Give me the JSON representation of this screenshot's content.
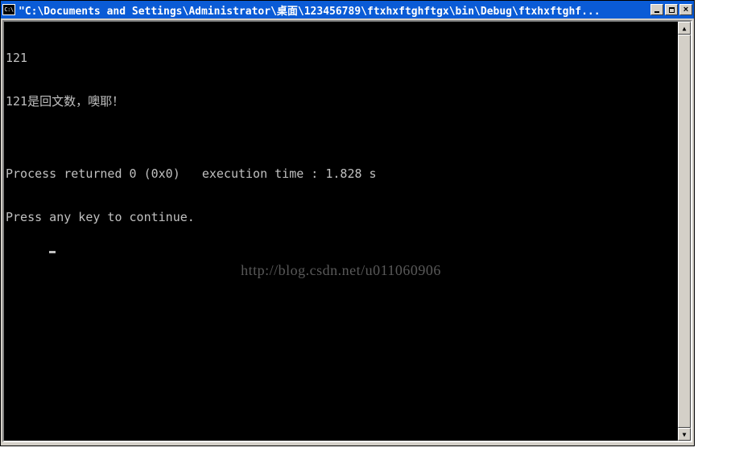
{
  "window": {
    "icon_label": "C:\\",
    "title": "\"C:\\Documents and Settings\\Administrator\\桌面\\123456789\\ftxhxftghftgx\\bin\\Debug\\ftxhxftghf..."
  },
  "controls": {
    "minimize": "_",
    "maximize": "□",
    "close": "×"
  },
  "console": {
    "lines": [
      "121",
      "121是回文数，噢耶！",
      "",
      "Process returned 0 (0x0)   execution time : 1.828 s",
      "Press any key to continue."
    ]
  },
  "scrollbar": {
    "up": "▲",
    "down": "▼"
  },
  "watermark": "http://blog.csdn.net/u011060906"
}
